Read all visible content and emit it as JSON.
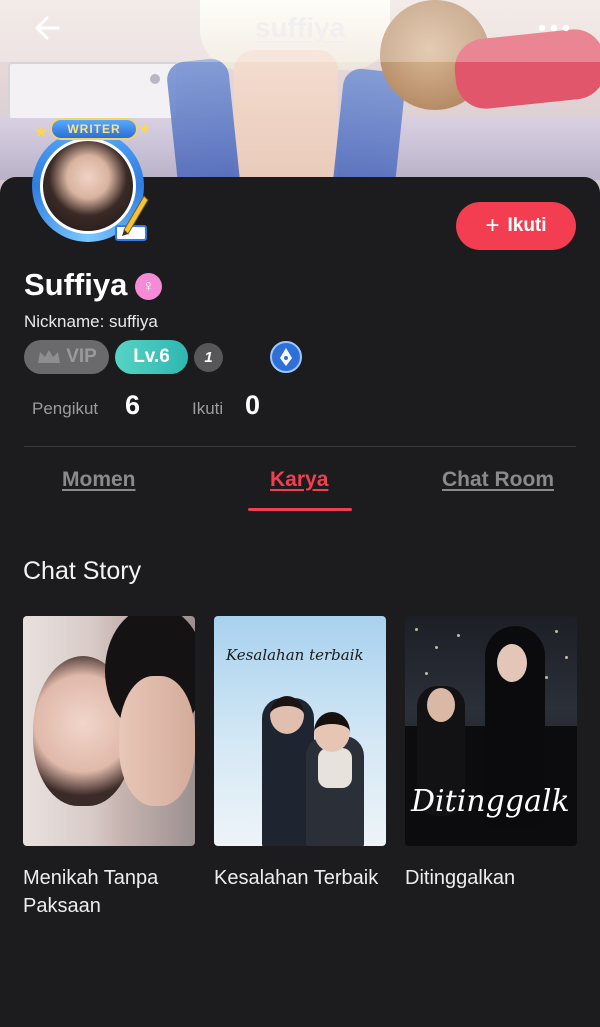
{
  "header": {
    "title": "suffiya",
    "back_icon": "arrow-left-icon",
    "more_icon": "more-horizontal-icon"
  },
  "profile": {
    "avatar_badge": "WRITER",
    "name": "Suffiya",
    "gender_symbol": "♀",
    "nickname": "Nickname: suffiya",
    "badges": {
      "vip": "VIP",
      "level": "Lv.6",
      "count": "1"
    },
    "stats": {
      "followers_label": "Pengikut",
      "followers_value": "6",
      "following_label": "Ikuti",
      "following_value": "0"
    },
    "follow_button": "Ikuti"
  },
  "tabs": [
    {
      "label": "Momen",
      "active": false
    },
    {
      "label": "Karya",
      "active": true
    },
    {
      "label": "Chat Room",
      "active": false
    }
  ],
  "section": {
    "title": "Chat Story"
  },
  "stories": [
    {
      "title": "Menikah Tanpa Paksaan",
      "cover_text": ""
    },
    {
      "title": "Kesalahan Terbaik",
      "cover_text": "Kesalahan terbaik"
    },
    {
      "title": "Ditinggalkan",
      "cover_text": "Ditinggalk"
    }
  ],
  "colors": {
    "accent": "#f23e50",
    "background": "#1c1c1e",
    "level_badge": "#2fb7b2",
    "gender_badge": "#f58ad6"
  }
}
